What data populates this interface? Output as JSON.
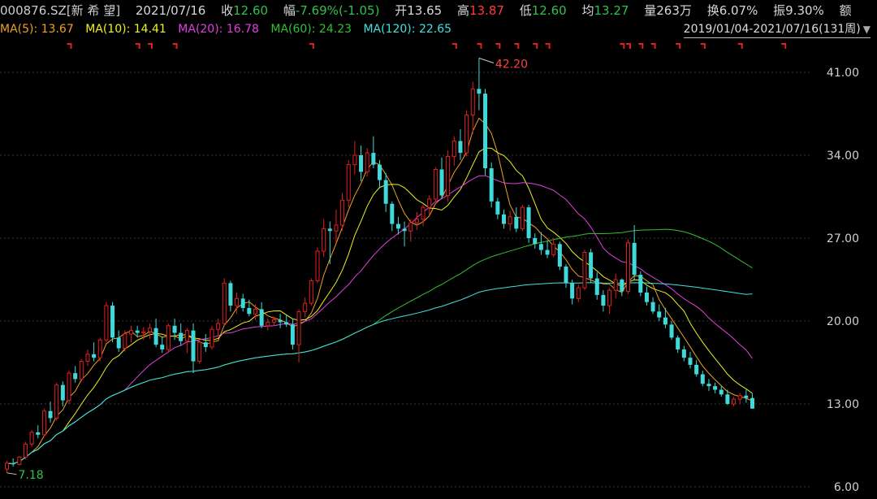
{
  "header": {
    "code": "000876.SZ[新 希 望]",
    "date": "2021/07/16",
    "close_label": "收",
    "close": "12.60",
    "change_label": "幅",
    "change": "-7.69%(-1.05)",
    "open_label": "开",
    "open": "13.65",
    "high_label": "高",
    "high": "13.87",
    "low_label": "低",
    "low": "12.60",
    "avg_label": "均",
    "avg": "13.27",
    "vol_label": "量",
    "vol": "263万",
    "turnover_label": "换",
    "turnover": "6.07%",
    "amp_label": "振",
    "amp": "9.30%",
    "amount_label": "额"
  },
  "ma_legend": [
    {
      "text": "MA(5): 13.67",
      "color": "#f0a020"
    },
    {
      "text": "MA(10): 14.41",
      "color": "#f0f020"
    },
    {
      "text": "MA(20): 16.78",
      "color": "#e040e0"
    },
    {
      "text": "MA(60): 24.23",
      "color": "#30c030"
    },
    {
      "text": "MA(120): 22.65",
      "color": "#40e0e0"
    }
  ],
  "range_label": "2019/01/04-2021/07/16(131周)",
  "chart_data": {
    "type": "candlestick",
    "period": "weekly",
    "ylim": [
      6,
      43
    ],
    "y_ticks": [
      "41.00",
      "34.00",
      "27.00",
      "20.00",
      "13.00",
      "6.00"
    ],
    "max_label": "42.20",
    "min_label": "7.18",
    "up_color": "#e02020",
    "down_color": "#40d8d8",
    "candles": [
      [
        7.5,
        8.2,
        7.18,
        8.0
      ],
      [
        8.0,
        8.4,
        7.7,
        7.9
      ],
      [
        7.9,
        8.6,
        7.8,
        8.5
      ],
      [
        8.5,
        9.8,
        8.3,
        9.6
      ],
      [
        9.6,
        10.8,
        9.4,
        10.6
      ],
      [
        10.6,
        11.2,
        10.1,
        10.4
      ],
      [
        10.4,
        12.6,
        10.2,
        12.4
      ],
      [
        12.4,
        13.2,
        11.4,
        11.8
      ],
      [
        11.8,
        14.8,
        11.6,
        14.6
      ],
      [
        14.6,
        14.9,
        12.8,
        13.3
      ],
      [
        13.3,
        15.8,
        13.0,
        15.6
      ],
      [
        15.6,
        16.2,
        14.8,
        15.1
      ],
      [
        15.1,
        16.8,
        14.9,
        16.6
      ],
      [
        16.6,
        17.6,
        16.2,
        17.2
      ],
      [
        17.2,
        18.2,
        16.6,
        16.9
      ],
      [
        16.9,
        18.6,
        16.6,
        18.4
      ],
      [
        18.4,
        21.6,
        18.2,
        21.3
      ],
      [
        21.3,
        21.6,
        18.2,
        18.6
      ],
      [
        18.6,
        19.2,
        17.4,
        17.7
      ],
      [
        17.7,
        19.2,
        17.4,
        18.9
      ],
      [
        18.9,
        19.6,
        18.2,
        19.2
      ],
      [
        19.2,
        19.6,
        18.6,
        19.0
      ],
      [
        19.0,
        19.5,
        18.4,
        19.1
      ],
      [
        19.1,
        19.8,
        18.5,
        19.4
      ],
      [
        19.4,
        20.2,
        17.8,
        18.0
      ],
      [
        18.0,
        18.7,
        17.3,
        17.6
      ],
      [
        17.6,
        19.8,
        17.4,
        19.6
      ],
      [
        19.6,
        20.2,
        18.4,
        19.0
      ],
      [
        19.0,
        19.8,
        17.9,
        18.3
      ],
      [
        18.3,
        19.4,
        17.3,
        19.2
      ],
      [
        19.2,
        19.8,
        15.6,
        16.6
      ],
      [
        16.6,
        18.4,
        16.4,
        18.2
      ],
      [
        18.2,
        18.9,
        17.4,
        17.8
      ],
      [
        17.8,
        19.6,
        17.6,
        19.3
      ],
      [
        19.3,
        20.2,
        18.8,
        19.8
      ],
      [
        19.8,
        23.6,
        19.6,
        23.2
      ],
      [
        23.2,
        23.4,
        20.8,
        21.3
      ],
      [
        21.3,
        22.4,
        20.6,
        21.9
      ],
      [
        21.9,
        22.3,
        20.8,
        21.1
      ],
      [
        21.1,
        21.8,
        20.4,
        20.6
      ],
      [
        20.6,
        21.4,
        20.1,
        21.0
      ],
      [
        21.0,
        21.6,
        19.4,
        19.6
      ],
      [
        19.6,
        20.2,
        19.2,
        19.9
      ],
      [
        19.9,
        20.4,
        19.6,
        20.1
      ],
      [
        20.1,
        20.6,
        19.4,
        19.9
      ],
      [
        19.9,
        20.5,
        19.5,
        19.7
      ],
      [
        19.7,
        20.2,
        17.6,
        18.0
      ],
      [
        18.0,
        21.0,
        16.5,
        20.8
      ],
      [
        20.8,
        22.0,
        20.3,
        21.5
      ],
      [
        21.5,
        23.6,
        21.3,
        23.4
      ],
      [
        23.4,
        26.2,
        23.2,
        25.9
      ],
      [
        25.9,
        28.6,
        25.4,
        27.8
      ],
      [
        27.8,
        28.4,
        24.8,
        27.6
      ],
      [
        27.6,
        29.4,
        26.6,
        28.1
      ],
      [
        28.1,
        30.8,
        27.6,
        30.2
      ],
      [
        30.2,
        33.6,
        29.6,
        33.2
      ],
      [
        33.2,
        35.2,
        32.4,
        34.0
      ],
      [
        34.0,
        34.8,
        31.8,
        32.6
      ],
      [
        32.6,
        34.6,
        32.2,
        34.2
      ],
      [
        34.2,
        35.6,
        32.9,
        33.2
      ],
      [
        33.2,
        33.6,
        31.2,
        31.9
      ],
      [
        31.9,
        32.5,
        29.2,
        29.9
      ],
      [
        29.9,
        30.1,
        27.6,
        28.2
      ],
      [
        28.2,
        28.8,
        27.3,
        27.8
      ],
      [
        27.8,
        28.4,
        26.3,
        27.6
      ],
      [
        27.6,
        28.6,
        26.7,
        28.3
      ],
      [
        28.3,
        29.2,
        27.7,
        28.6
      ],
      [
        28.6,
        29.8,
        28.0,
        29.6
      ],
      [
        29.6,
        30.6,
        28.9,
        30.3
      ],
      [
        30.3,
        33.0,
        30.1,
        32.8
      ],
      [
        32.8,
        33.8,
        30.4,
        30.6
      ],
      [
        30.6,
        34.4,
        30.1,
        33.9
      ],
      [
        33.9,
        35.6,
        33.1,
        35.2
      ],
      [
        35.2,
        36.2,
        33.6,
        34.2
      ],
      [
        34.2,
        37.8,
        33.9,
        37.4
      ],
      [
        37.4,
        40.2,
        35.8,
        39.6
      ],
      [
        39.6,
        42.2,
        37.8,
        39.2
      ],
      [
        39.2,
        39.6,
        32.3,
        32.9
      ],
      [
        32.9,
        33.4,
        29.6,
        30.1
      ],
      [
        30.1,
        30.4,
        28.6,
        29.0
      ],
      [
        29.0,
        29.4,
        27.8,
        28.2
      ],
      [
        28.2,
        29.3,
        27.6,
        28.8
      ],
      [
        28.8,
        29.6,
        27.5,
        27.8
      ],
      [
        27.8,
        29.8,
        27.6,
        29.6
      ],
      [
        29.6,
        29.8,
        26.6,
        27.0
      ],
      [
        27.0,
        27.4,
        26.1,
        26.5
      ],
      [
        26.5,
        27.5,
        25.6,
        26.0
      ],
      [
        26.0,
        26.8,
        25.3,
        25.6
      ],
      [
        25.6,
        27.0,
        25.4,
        26.5
      ],
      [
        26.5,
        26.7,
        24.3,
        24.6
      ],
      [
        24.6,
        24.8,
        22.8,
        23.2
      ],
      [
        23.2,
        23.5,
        21.4,
        21.9
      ],
      [
        21.9,
        23.1,
        21.6,
        22.8
      ],
      [
        22.8,
        26.0,
        22.6,
        25.8
      ],
      [
        25.8,
        26.1,
        23.2,
        23.6
      ],
      [
        23.6,
        24.1,
        21.8,
        22.2
      ],
      [
        22.2,
        22.6,
        20.8,
        21.3
      ],
      [
        21.3,
        22.8,
        20.6,
        22.6
      ],
      [
        22.6,
        24.0,
        21.9,
        23.5
      ],
      [
        23.5,
        23.6,
        22.1,
        22.5
      ],
      [
        22.5,
        26.9,
        22.3,
        26.6
      ],
      [
        26.6,
        28.1,
        23.5,
        23.9
      ],
      [
        23.9,
        24.2,
        22.1,
        22.4
      ],
      [
        22.4,
        22.9,
        21.3,
        21.6
      ],
      [
        21.6,
        22.0,
        20.6,
        20.8
      ],
      [
        20.8,
        21.4,
        20.0,
        20.3
      ],
      [
        20.3,
        21.1,
        19.4,
        19.7
      ],
      [
        19.7,
        20.0,
        18.4,
        18.6
      ],
      [
        18.6,
        18.8,
        17.3,
        17.6
      ],
      [
        17.6,
        17.9,
        16.6,
        16.9
      ],
      [
        16.9,
        17.4,
        16.0,
        16.3
      ],
      [
        16.3,
        16.7,
        15.3,
        15.5
      ],
      [
        15.5,
        15.8,
        14.5,
        14.7
      ],
      [
        14.7,
        15.1,
        14.1,
        14.5
      ],
      [
        14.5,
        14.8,
        13.9,
        14.2
      ],
      [
        14.2,
        14.5,
        13.6,
        13.8
      ],
      [
        13.8,
        14.2,
        12.9,
        13.0
      ],
      [
        13.0,
        13.6,
        12.8,
        13.4
      ],
      [
        13.4,
        13.9,
        13.0,
        13.7
      ],
      [
        13.7,
        14.2,
        13.1,
        13.5
      ],
      [
        13.5,
        13.87,
        12.6,
        12.6
      ]
    ]
  }
}
